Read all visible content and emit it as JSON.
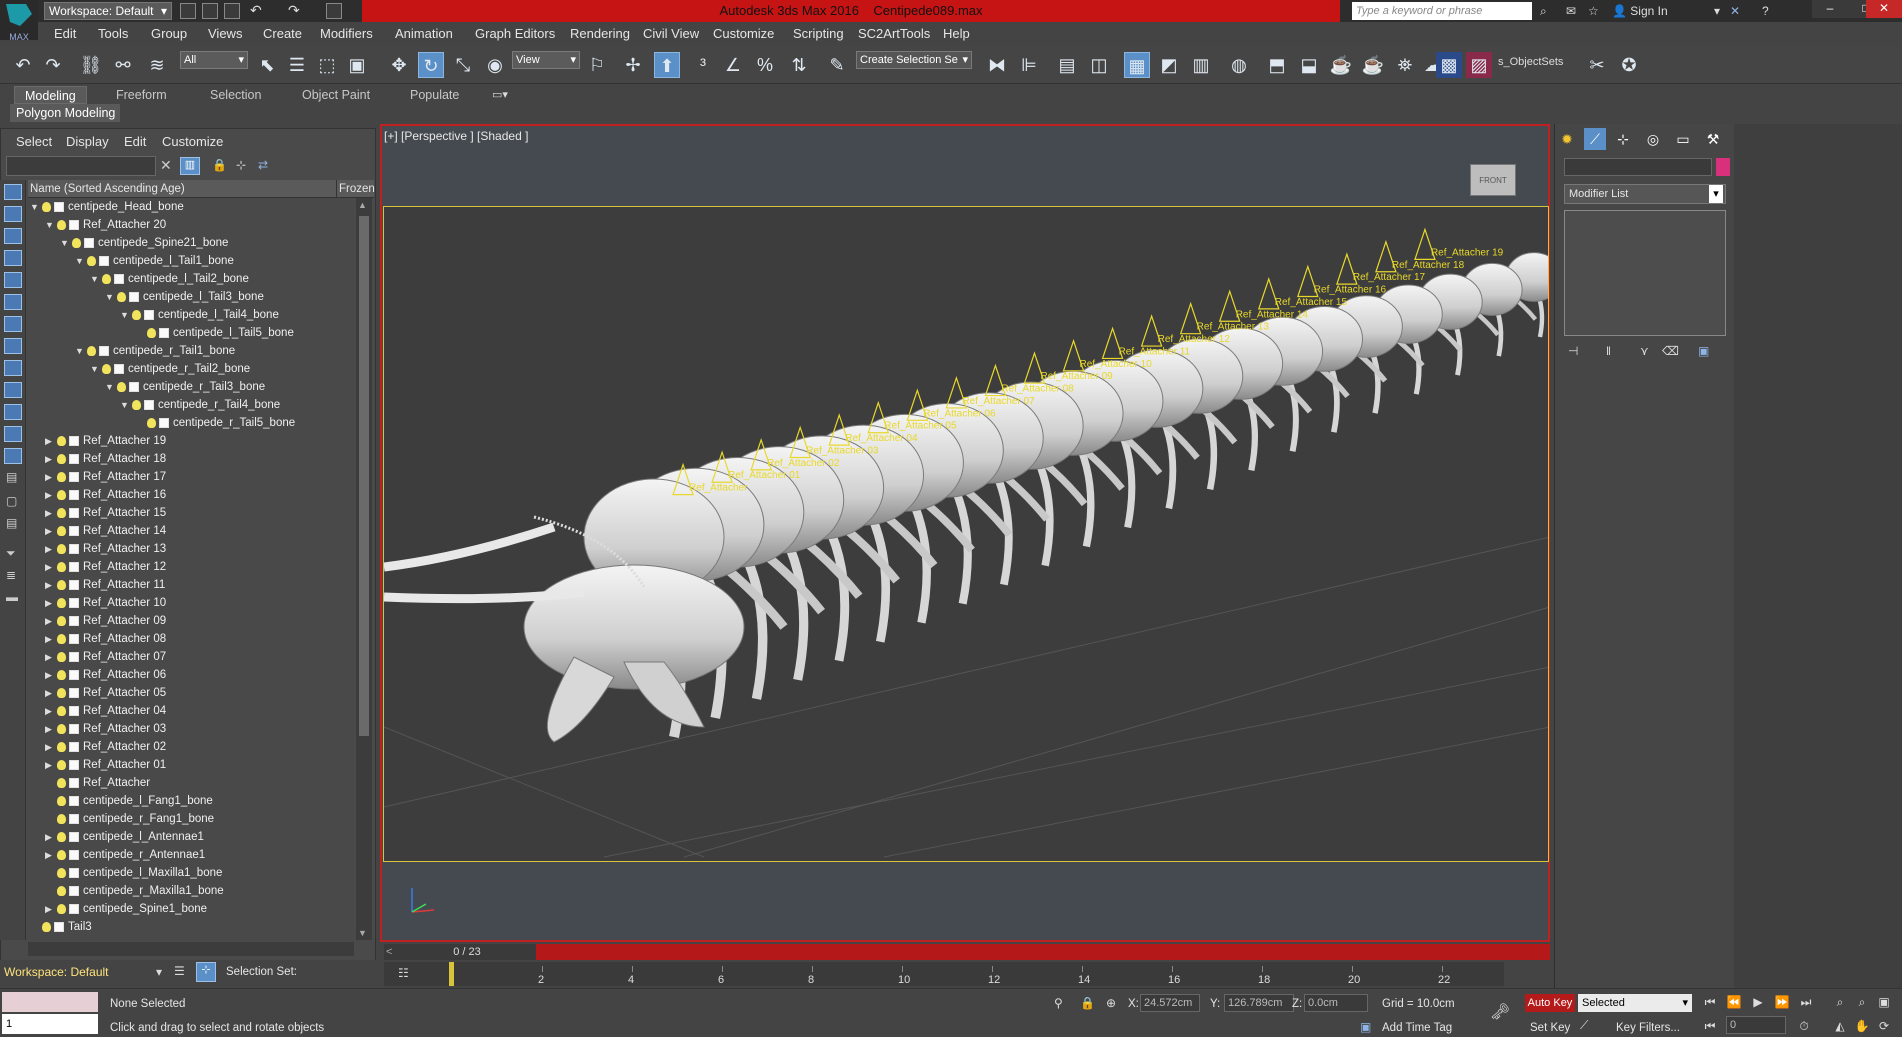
{
  "title": {
    "app": "Autodesk 3ds Max 2016",
    "file": "Centipede089.max"
  },
  "workspace": "Workspace: Default",
  "search_placeholder": "Type a keyword or phrase",
  "sign_in": "Sign In",
  "menus": [
    "Edit",
    "Tools",
    "Group",
    "Views",
    "Create",
    "Modifiers",
    "Animation",
    "Graph Editors",
    "Rendering",
    "Civil View",
    "Customize",
    "Scripting",
    "SC2ArtTools",
    "Help"
  ],
  "toolbar": {
    "filter": "All",
    "coord": "View",
    "selection_set": "Create Selection Se",
    "objectsets": "s_ObjectSets"
  },
  "ribbon": {
    "tabs": [
      "Modeling",
      "Freeform",
      "Selection",
      "Object Paint",
      "Populate"
    ],
    "sub": "Polygon Modeling"
  },
  "explorer": {
    "menu": [
      "Select",
      "Display",
      "Edit",
      "Customize"
    ],
    "col_name": "Name (Sorted Ascending Age)",
    "col_frozen": "Frozen",
    "rows": [
      {
        "d": 1,
        "a": "v",
        "n": "centipede_Head_bone"
      },
      {
        "d": 2,
        "a": "v",
        "n": "Ref_Attacher 20"
      },
      {
        "d": 3,
        "a": "v",
        "n": "centipede_Spine21_bone"
      },
      {
        "d": 4,
        "a": "v",
        "n": "centipede_l_Tail1_bone"
      },
      {
        "d": 5,
        "a": "v",
        "n": "centipede_l_Tail2_bone"
      },
      {
        "d": 6,
        "a": "v",
        "n": "centipede_l_Tail3_bone"
      },
      {
        "d": 7,
        "a": "v",
        "n": "centipede_l_Tail4_bone"
      },
      {
        "d": 8,
        "a": "",
        "n": "centipede_l_Tail5_bone"
      },
      {
        "d": 4,
        "a": "v",
        "n": "centipede_r_Tail1_bone"
      },
      {
        "d": 5,
        "a": "v",
        "n": "centipede_r_Tail2_bone"
      },
      {
        "d": 6,
        "a": "v",
        "n": "centipede_r_Tail3_bone"
      },
      {
        "d": 7,
        "a": "v",
        "n": "centipede_r_Tail4_bone"
      },
      {
        "d": 8,
        "a": "",
        "n": "centipede_r_Tail5_bone"
      },
      {
        "d": 2,
        "a": ">",
        "n": "Ref_Attacher 19"
      },
      {
        "d": 2,
        "a": ">",
        "n": "Ref_Attacher 18"
      },
      {
        "d": 2,
        "a": ">",
        "n": "Ref_Attacher 17"
      },
      {
        "d": 2,
        "a": ">",
        "n": "Ref_Attacher 16"
      },
      {
        "d": 2,
        "a": ">",
        "n": "Ref_Attacher 15"
      },
      {
        "d": 2,
        "a": ">",
        "n": "Ref_Attacher 14"
      },
      {
        "d": 2,
        "a": ">",
        "n": "Ref_Attacher 13"
      },
      {
        "d": 2,
        "a": ">",
        "n": "Ref_Attacher 12"
      },
      {
        "d": 2,
        "a": ">",
        "n": "Ref_Attacher 11"
      },
      {
        "d": 2,
        "a": ">",
        "n": "Ref_Attacher 10"
      },
      {
        "d": 2,
        "a": ">",
        "n": "Ref_Attacher 09"
      },
      {
        "d": 2,
        "a": ">",
        "n": "Ref_Attacher 08"
      },
      {
        "d": 2,
        "a": ">",
        "n": "Ref_Attacher 07"
      },
      {
        "d": 2,
        "a": ">",
        "n": "Ref_Attacher 06"
      },
      {
        "d": 2,
        "a": ">",
        "n": "Ref_Attacher 05"
      },
      {
        "d": 2,
        "a": ">",
        "n": "Ref_Attacher 04"
      },
      {
        "d": 2,
        "a": ">",
        "n": "Ref_Attacher 03"
      },
      {
        "d": 2,
        "a": ">",
        "n": "Ref_Attacher 02"
      },
      {
        "d": 2,
        "a": ">",
        "n": "Ref_Attacher 01"
      },
      {
        "d": 2,
        "a": "",
        "n": "Ref_Attacher"
      },
      {
        "d": 2,
        "a": "",
        "n": "centipede_l_Fang1_bone"
      },
      {
        "d": 2,
        "a": "",
        "n": "centipede_r_Fang1_bone"
      },
      {
        "d": 2,
        "a": ">",
        "n": "centipede_l_Antennae1"
      },
      {
        "d": 2,
        "a": ">",
        "n": "centipede_r_Antennae1"
      },
      {
        "d": 2,
        "a": "",
        "n": "centipede_l_Maxilla1_bone"
      },
      {
        "d": 2,
        "a": "",
        "n": "centipede_r_Maxilla1_bone"
      },
      {
        "d": 2,
        "a": ">",
        "n": "centipede_Spine1_bone"
      },
      {
        "d": 1,
        "a": "",
        "n": "Tail3"
      }
    ],
    "selection_set_label": "Selection Set:"
  },
  "viewport": {
    "label": "[+] [Perspective ] [Shaded ]",
    "viewcube": "FRONT",
    "attachers": [
      "Ref_Attacher",
      "Ref_Attacher 01",
      "Ref_Attacher 02",
      "Ref_Attacher 03",
      "Ref_Attacher 04",
      "Ref_Attacher 05",
      "Ref_Attacher 06",
      "Ref_Attacher 07",
      "Ref_Attacher 08",
      "Ref_Attacher 09",
      "Ref_Attacher 10",
      "Ref_Attacher 11",
      "Ref_Attacher 12",
      "Ref_Attacher 13",
      "Ref_Attacher 14",
      "Ref_Attacher 15",
      "Ref_Attacher 16",
      "Ref_Attacher 17",
      "Ref_Attacher 18",
      "Ref_Attacher 19"
    ],
    "colors": {
      "attacher": "#e8d82a",
      "frame": "#d8c43a",
      "active_border": "#c02020"
    }
  },
  "command_panel": {
    "modifier_list": "Modifier List"
  },
  "timeline": {
    "frame": "0 / 23",
    "ticks": [
      "2",
      "4",
      "6",
      "8",
      "10",
      "12",
      "14",
      "16",
      "18",
      "20",
      "22"
    ]
  },
  "status": {
    "selection": "None Selected",
    "prompt": "Click and drag to select and rotate objects",
    "x": "24.572cm",
    "y": "126.789cm",
    "z": "0.0cm",
    "grid": "Grid = 10.0cm",
    "add_time_tag": "Add Time Tag",
    "auto_key": "Auto Key",
    "set_key": "Set Key",
    "selected": "Selected",
    "key_filters": "Key Filters...",
    "frame_field": "0",
    "listener_value": "1",
    "x_label": "X:",
    "y_label": "Y:",
    "z_label": "Z:"
  }
}
